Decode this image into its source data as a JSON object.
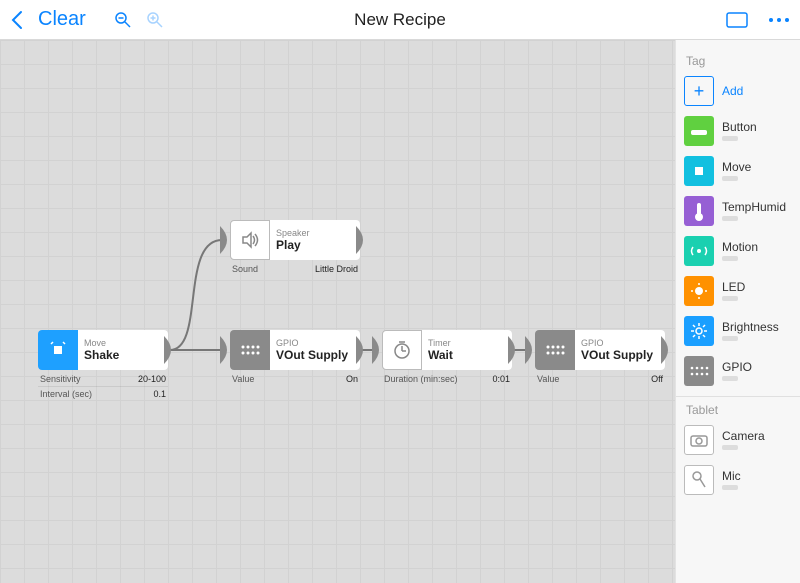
{
  "toolbar": {
    "clear_label": "Clear",
    "title": "New Recipe"
  },
  "nodes": {
    "shake": {
      "type": "Move",
      "name": "Shake",
      "params": [
        {
          "label": "Sensitivity",
          "value": "20-100"
        },
        {
          "label": "Interval (sec)",
          "value": "0.1"
        }
      ]
    },
    "speaker": {
      "type": "Speaker",
      "name": "Play",
      "params": [
        {
          "label": "Sound",
          "value": "Little Droid"
        }
      ]
    },
    "gpio_on": {
      "type": "GPIO",
      "name": "VOut Supply",
      "params": [
        {
          "label": "Value",
          "value": "On"
        }
      ]
    },
    "timer": {
      "type": "Timer",
      "name": "Wait",
      "params": [
        {
          "label": "Duration (min:sec)",
          "value": "0:01"
        }
      ]
    },
    "gpio_off": {
      "type": "GPIO",
      "name": "VOut Supply",
      "params": [
        {
          "label": "Value",
          "value": "Off"
        }
      ]
    }
  },
  "sidebar": {
    "sections": {
      "tag": {
        "title": "Tag",
        "add_label": "Add",
        "items": [
          "Button",
          "Move",
          "TempHumid",
          "Motion",
          "LED",
          "Brightness",
          "GPIO"
        ]
      },
      "tablet": {
        "title": "Tablet",
        "items": [
          "Camera",
          "Mic"
        ]
      }
    }
  },
  "colors": {
    "accent": "#0a84ff"
  }
}
